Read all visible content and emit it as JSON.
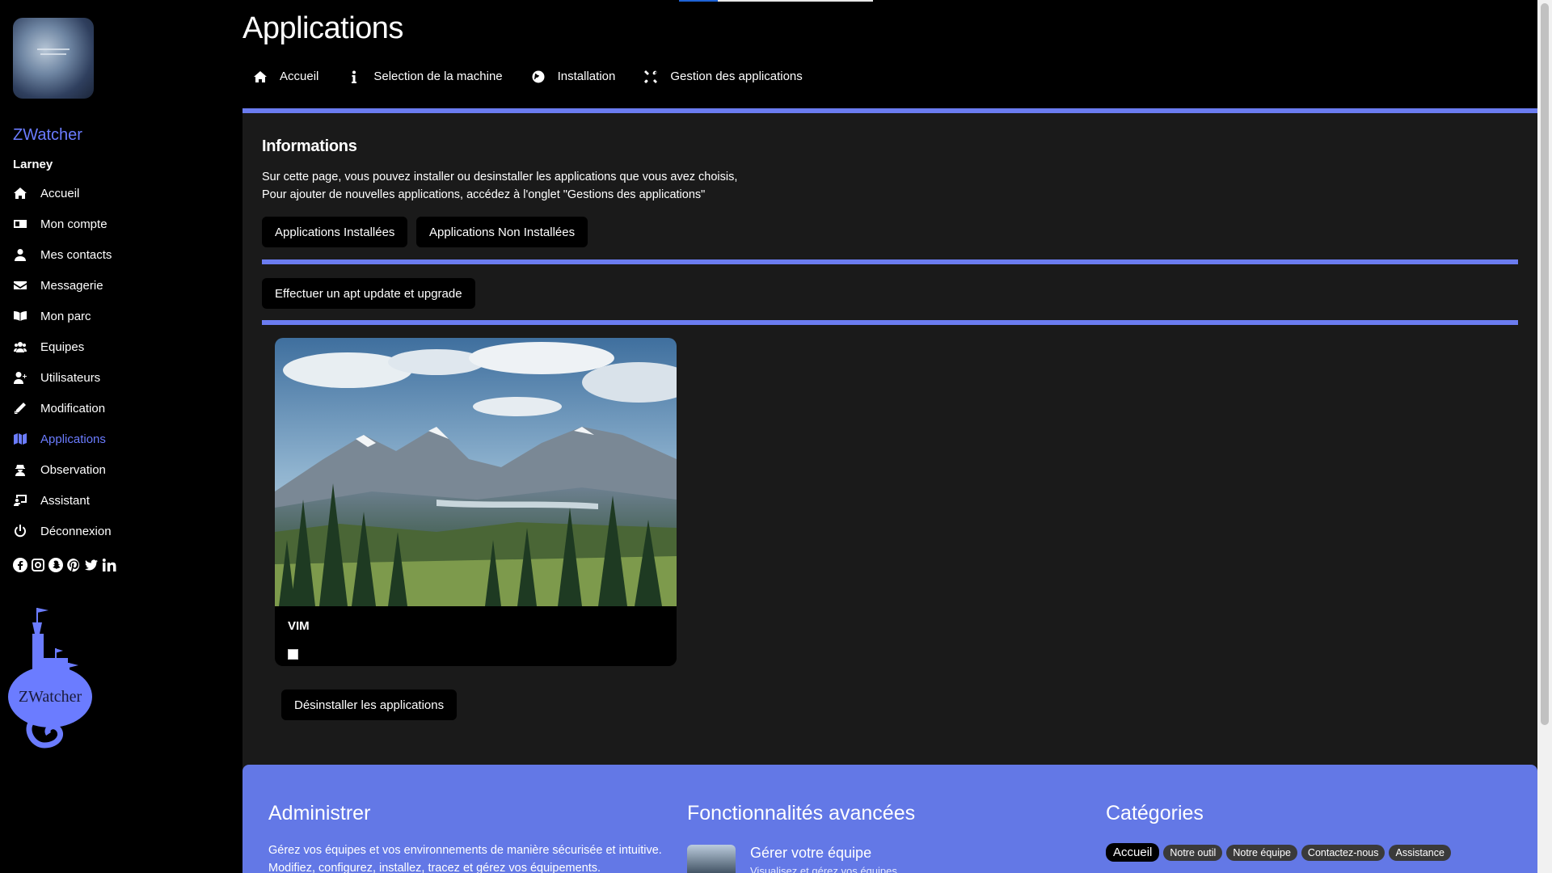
{
  "sidebar": {
    "brand": "ZWatcher",
    "username": "Larney",
    "items": [
      {
        "label": "Accueil",
        "icon": "home-icon"
      },
      {
        "label": "Mon compte",
        "icon": "id-card-icon"
      },
      {
        "label": "Mes contacts",
        "icon": "user-icon"
      },
      {
        "label": "Messagerie",
        "icon": "envelope-icon"
      },
      {
        "label": "Mon parc",
        "icon": "book-icon"
      },
      {
        "label": "Equipes",
        "icon": "users-icon"
      },
      {
        "label": "Utilisateurs",
        "icon": "user-plus-icon"
      },
      {
        "label": "Modification",
        "icon": "pencil-icon"
      },
      {
        "label": "Applications",
        "icon": "map-icon",
        "active": true
      },
      {
        "label": "Observation",
        "icon": "user-secret-icon"
      },
      {
        "label": "Assistant",
        "icon": "chalkboard-icon"
      },
      {
        "label": "Déconnexion",
        "icon": "power-icon"
      }
    ],
    "social": [
      "facebook-icon",
      "instagram-icon",
      "snapchat-icon",
      "pinterest-icon",
      "twitter-icon",
      "linkedin-icon"
    ],
    "logo_text": "ZWatcher",
    "logo_color": "#6b7cff"
  },
  "header": {
    "title": "Applications",
    "tabs": [
      {
        "label": "Accueil",
        "icon": "home-icon"
      },
      {
        "label": "Selection de la machine",
        "icon": "info-icon"
      },
      {
        "label": "Installation",
        "icon": "globe-icon"
      },
      {
        "label": "Gestion des applications",
        "icon": "tools-icon"
      }
    ]
  },
  "main": {
    "info_title": "Informations",
    "info_line1": "Sur cette page, vous pouvez installer ou desinstaller les applications que vous avez choisis,",
    "info_line2": "Pour ajouter de nouvelles applications, accédez à l'onglet \"Gestions des applications\"",
    "btn_installed": "Applications Installées",
    "btn_not_installed": "Applications Non Installées",
    "btn_update": "Effectuer un apt update et upgrade",
    "app_card": {
      "name": "VIM",
      "checked": false
    },
    "btn_uninstall": "Désinstaller les applications"
  },
  "footer": {
    "col1": {
      "title": "Administrer",
      "text": "Gérez vos équipes et vos environnements de manière sécurisée et intuitive. Modifiez, configurez, installez, tracez et gérez vos équipements."
    },
    "col2": {
      "title": "Fonctionnalités avancées",
      "item_title": "Gérer votre équipe",
      "item_sub": "Visualisez et gérez vos équipes"
    },
    "col3": {
      "title": "Catégories",
      "tags": [
        "Accueil",
        "Notre outil",
        "Notre équipe",
        "Contactez-nous",
        "Assistance"
      ]
    }
  },
  "colors": {
    "accent": "#6b7cf0",
    "footer_bg": "#6378e6",
    "active_nav": "#6b7cff"
  }
}
